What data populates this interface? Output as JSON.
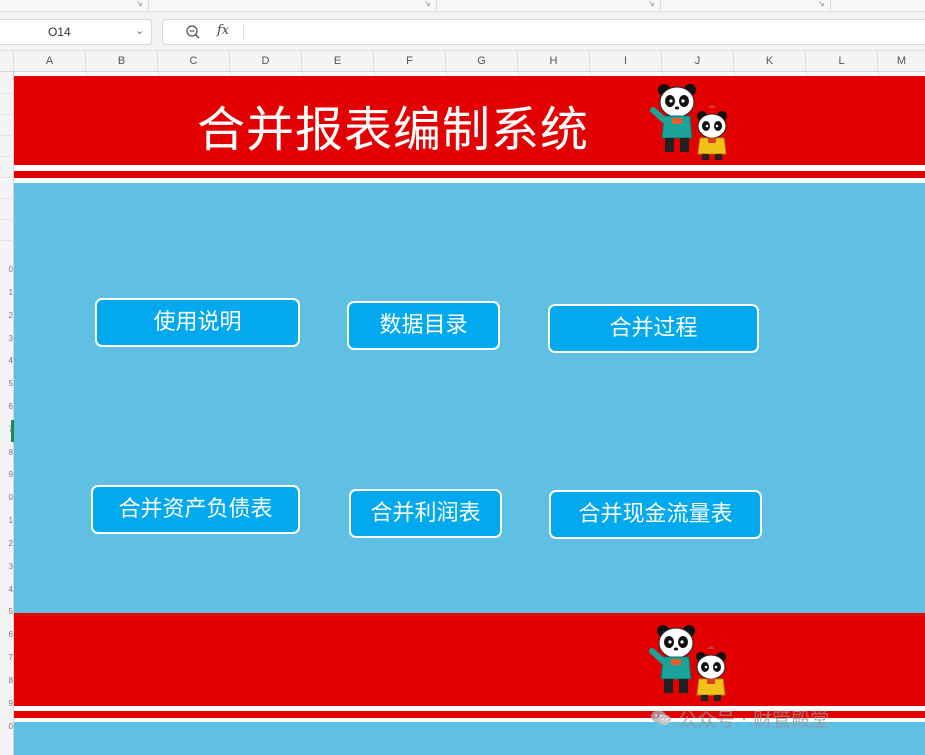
{
  "formula_bar": {
    "name_box": "O14",
    "fx_label": "fx",
    "formula": ""
  },
  "columns": [
    "A",
    "B",
    "C",
    "D",
    "E",
    "F",
    "G",
    "H",
    "I",
    "J",
    "K",
    "L",
    "M"
  ],
  "rows": [
    "0",
    "1",
    "2",
    "3",
    "4",
    "5",
    "6",
    "7",
    "8",
    "9",
    "0",
    "1",
    "2",
    "3",
    "4",
    "5",
    "6",
    "7",
    "8",
    "9",
    "0"
  ],
  "banner": {
    "title": "合并报表编制系统"
  },
  "buttons": {
    "instructions": "使用说明",
    "data_directory": "数据目录",
    "consolidation_process": "合并过程",
    "balance_sheet": "合并资产负债表",
    "income_statement": "合并利润表",
    "cash_flow": "合并现金流量表"
  },
  "watermark": {
    "text": "公众号 · 财管殿堂",
    "icon": "wechat-icon"
  },
  "colors": {
    "banner_red": "#e20000",
    "sheet_blue": "#5fc0e3",
    "button_blue": "#03a9ee",
    "active_row_green": "#1e8a4f"
  },
  "icons": {
    "zoom": "zoom-in-icon",
    "launcher": "dialog-launcher-icon",
    "dropdown": "chevron-down-icon",
    "mascot": "panda-mascot-icon"
  }
}
